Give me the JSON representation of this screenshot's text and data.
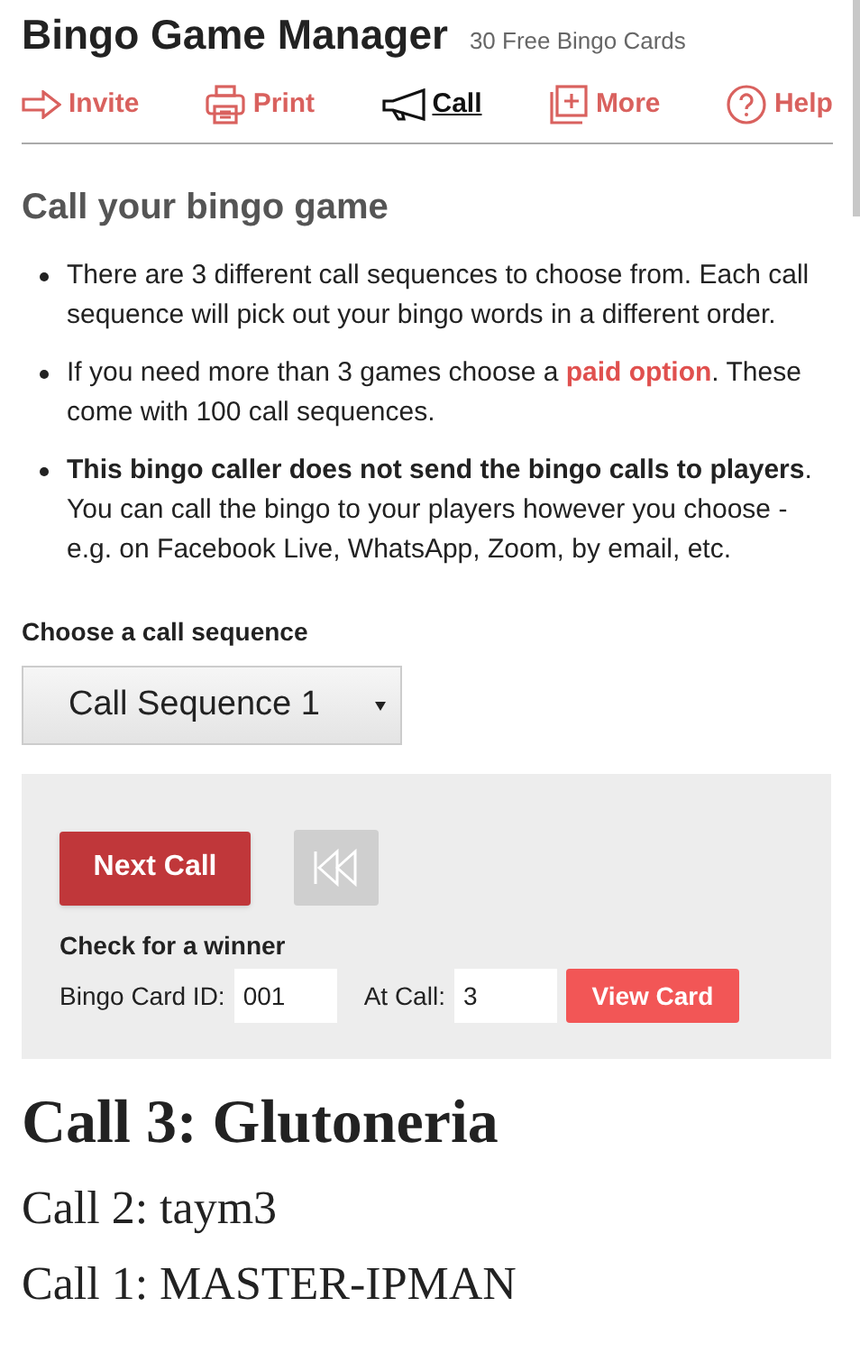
{
  "header": {
    "title": "Bingo Game Manager",
    "subtitle": "30 Free Bingo Cards"
  },
  "nav": [
    {
      "kind": "invite",
      "label": "Invite",
      "selected": false
    },
    {
      "kind": "print",
      "label": "Print",
      "selected": false
    },
    {
      "kind": "call",
      "label": "Call",
      "selected": true
    },
    {
      "kind": "more",
      "label": "More",
      "selected": false
    },
    {
      "kind": "help",
      "label": "Help",
      "selected": false
    }
  ],
  "heading": "Call your bingo game",
  "bullets": [
    {
      "before": "There are 3 different call sequences to choose from. Each call sequence will pick out your bingo words in a different order."
    },
    {
      "before": "If you need more than 3 games choose a ",
      "link": "paid option",
      "after": ". These come with 100 call sequences."
    },
    {
      "before": "**This bingo caller does not send the bingo calls to players**. You can call the bingo to your players however you choose - e.g. on Facebook Live, WhatsApp, Zoom, by email, etc."
    }
  ],
  "sequence": {
    "label": "Choose a call sequence",
    "value": "Call Sequence 1"
  },
  "controls": {
    "next_button": "Next Call",
    "rewind_disabled": true,
    "check_label": "Check for a winner",
    "card_id_label": "Bingo Card ID:",
    "card_id": "001",
    "at_call_label": "At Call:",
    "at_call": "3",
    "view_button": "View Card"
  },
  "calls": [
    "Call 3: Glutoneria",
    "Call 2: taym3",
    "Call 1: MASTER-IPMAN"
  ]
}
